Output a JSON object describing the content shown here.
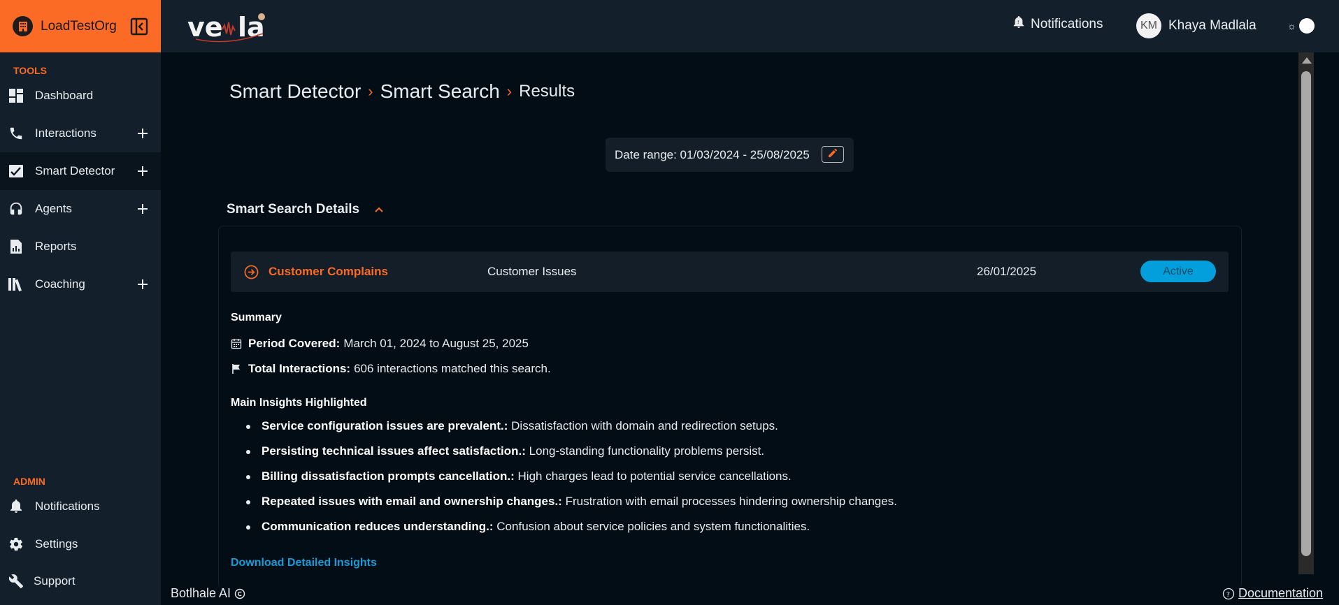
{
  "org": {
    "name": "LoadTestOrg"
  },
  "sidebar": {
    "tools_heading": "TOOLS",
    "admin_heading": "ADMIN",
    "tools": [
      {
        "label": "Dashboard",
        "icon": "dashboard-icon"
      },
      {
        "label": "Interactions",
        "icon": "phone-icon"
      },
      {
        "label": "Smart Detector",
        "icon": "checkbox-chart-icon"
      },
      {
        "label": "Agents",
        "icon": "headset-icon"
      },
      {
        "label": "Reports",
        "icon": "report-icon"
      },
      {
        "label": "Coaching",
        "icon": "books-icon"
      }
    ],
    "admin": [
      {
        "label": "Notifications",
        "icon": "bell-icon"
      },
      {
        "label": "Settings",
        "icon": "gear-icon"
      },
      {
        "label": "Support",
        "icon": "wrench-icon"
      }
    ]
  },
  "header": {
    "logo_text": "ve la",
    "notifications_label": "Notifications",
    "user_initials": "KM",
    "user_name": "Khaya Madlala",
    "theme_icon": "sun-icon"
  },
  "breadcrumb": {
    "items": [
      "Smart Detector",
      "Smart Search",
      "Results"
    ]
  },
  "date_range": {
    "label": "Date range: 01/03/2024 - 25/08/2025"
  },
  "details": {
    "title": "Smart Search Details",
    "row": {
      "name": "Customer Complains",
      "category": "Customer Issues",
      "date": "26/01/2025",
      "status": "Active"
    },
    "summary_heading": "Summary",
    "period_label": "Period Covered:",
    "period_value": "March 01, 2024 to August 25, 2025",
    "interactions_label": "Total Interactions:",
    "interactions_value": "606 interactions matched this search.",
    "insights_heading": "Main Insights Highlighted",
    "insights": [
      {
        "title": "Service configuration issues are prevalent.:",
        "text": "Dissatisfaction with domain and redirection setups."
      },
      {
        "title": "Persisting technical issues affect satisfaction.:",
        "text": "Long-standing functionality problems persist."
      },
      {
        "title": "Billing dissatisfaction prompts cancellation.:",
        "text": "High charges lead to potential service cancellations."
      },
      {
        "title": "Repeated issues with email and ownership changes.:",
        "text": "Frustration with email processes hindering ownership changes."
      },
      {
        "title": "Communication reduces understanding.:",
        "text": "Confusion about service policies and system functionalities."
      }
    ],
    "download_label": "Download Detailed Insights"
  },
  "footer": {
    "brand": "Botlhale AI",
    "documentation": "Documentation"
  },
  "colors": {
    "accent": "#fb6b25",
    "link": "#1a9ad6",
    "status_active": "#039fdc",
    "background": "#030d15",
    "panel": "#13202b"
  }
}
